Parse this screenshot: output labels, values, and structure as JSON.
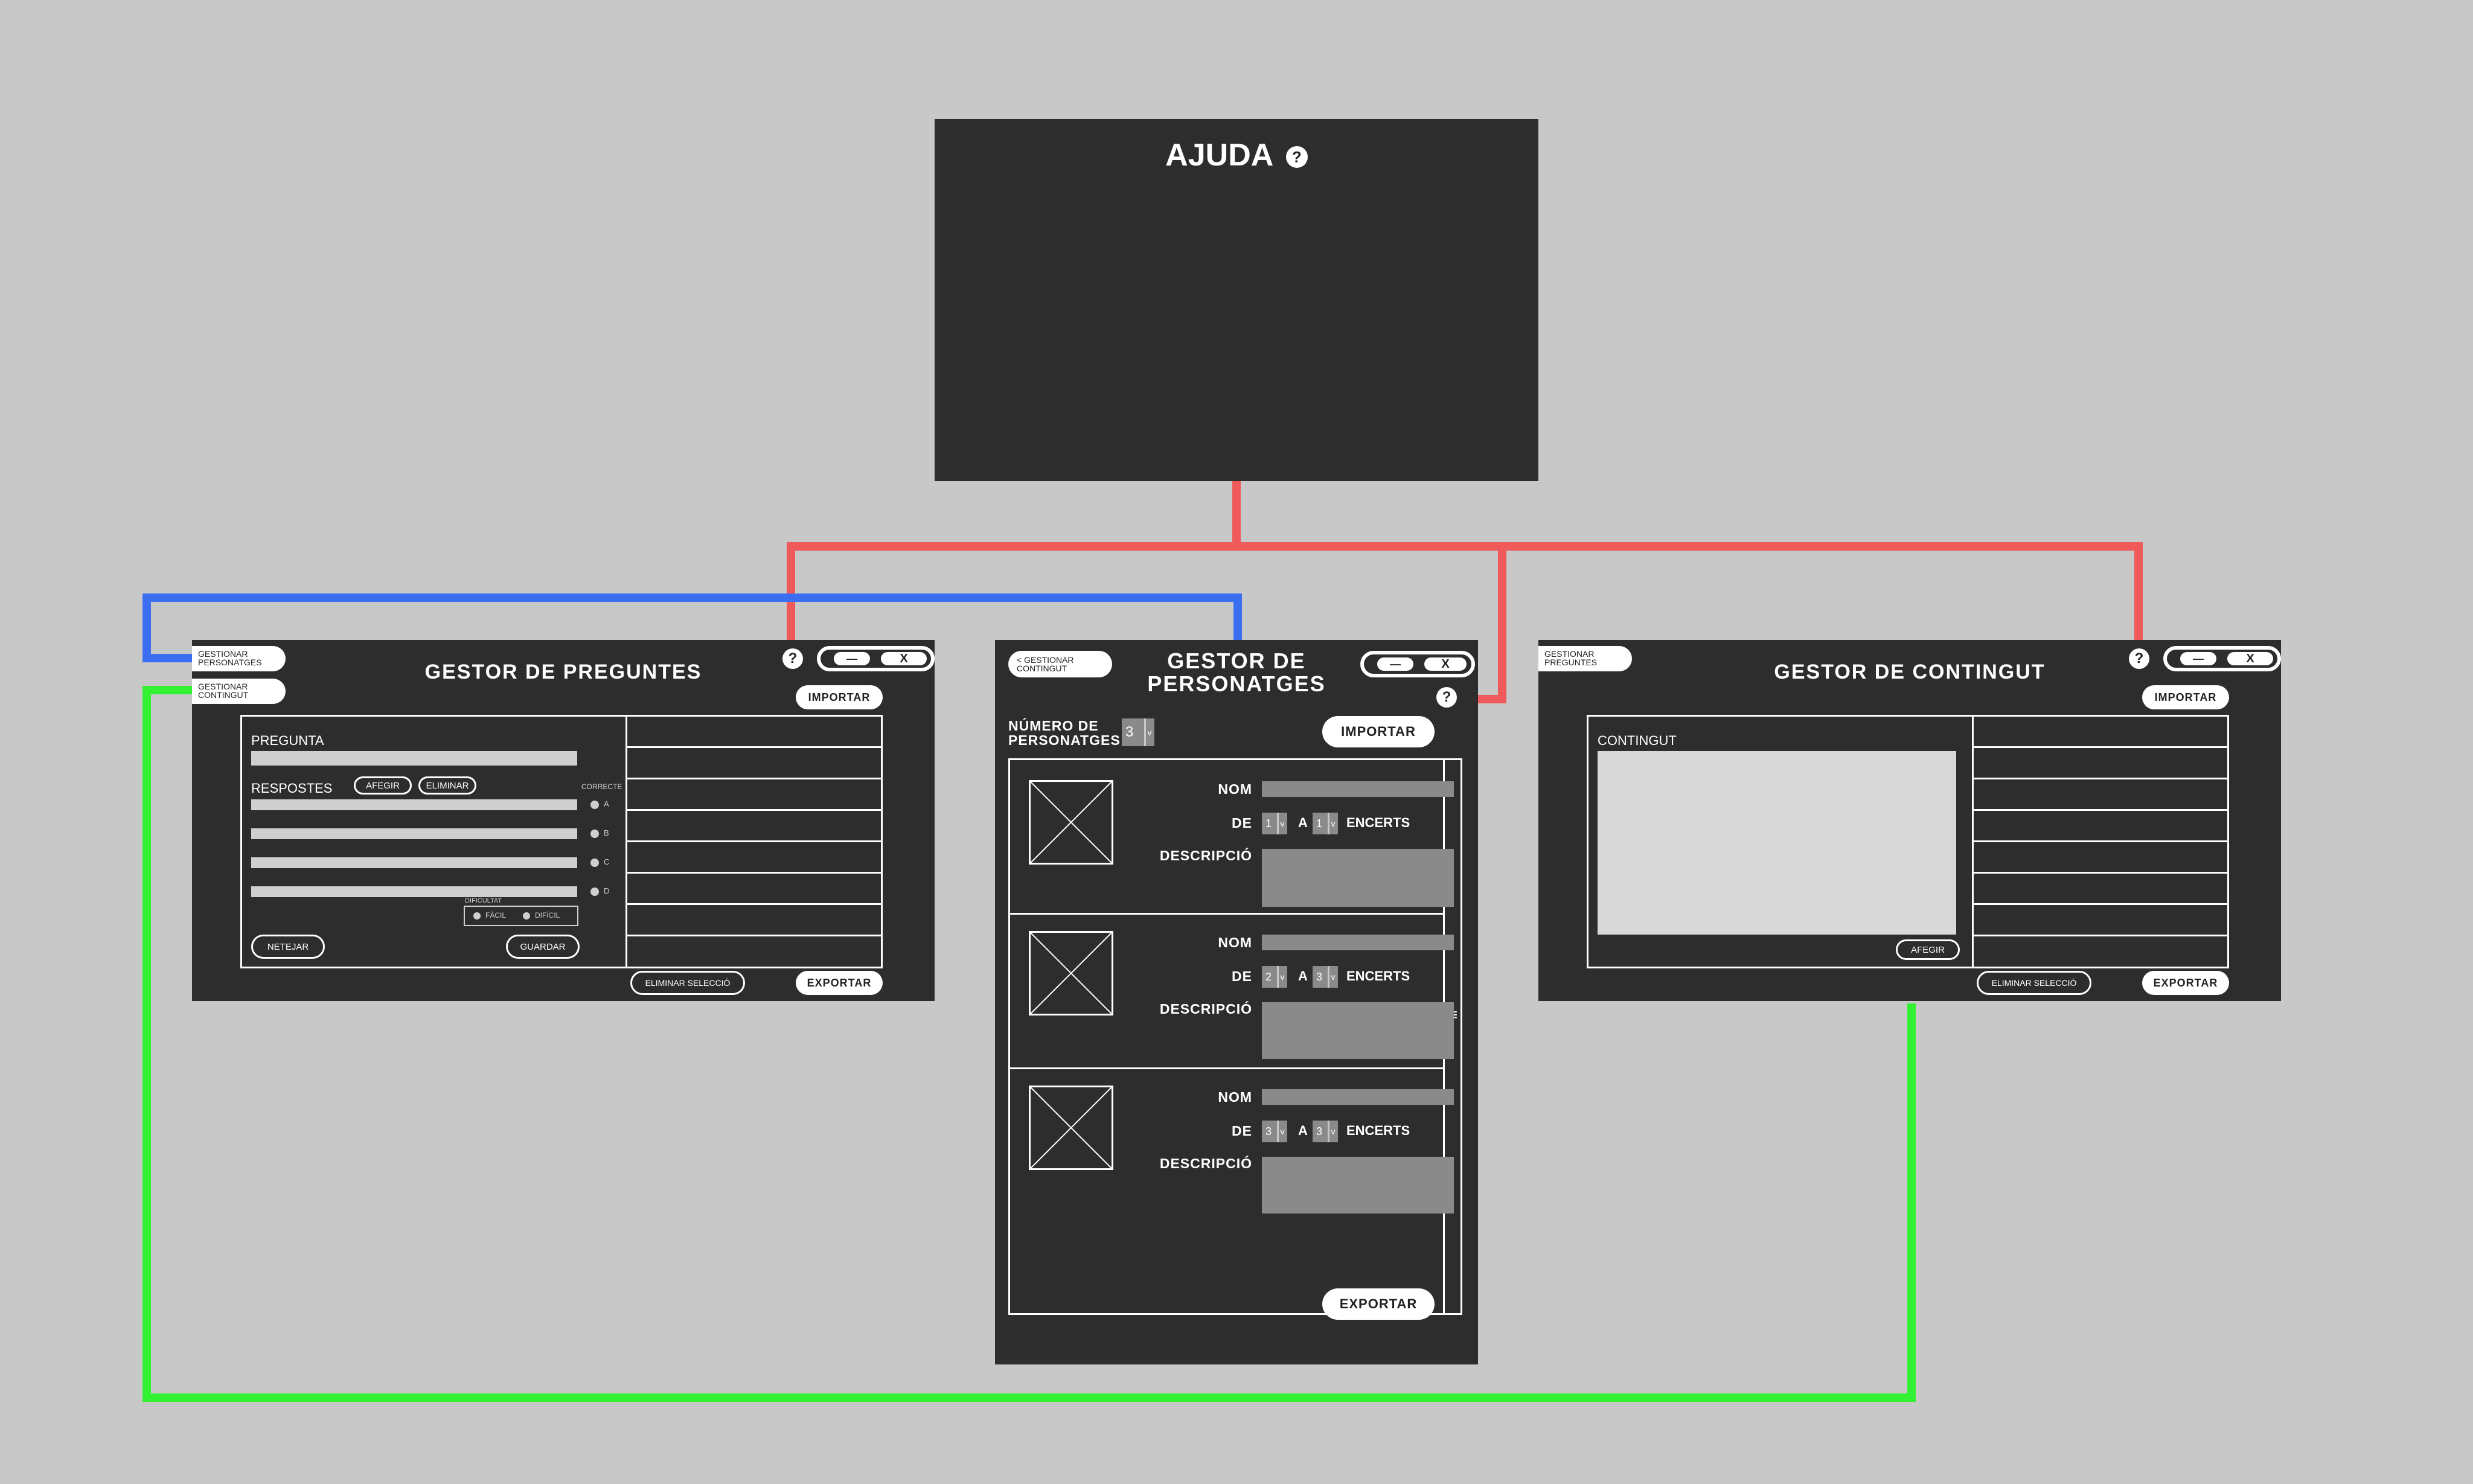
{
  "colors": {
    "background": "#c8c8c8",
    "panel": "#2d2d2d",
    "connector_help": "#f05a5a",
    "connector_personatges": "#3b6ef0",
    "connector_contingut": "#33f033"
  },
  "help_panel": {
    "title": "AJUDA",
    "help_icon": "?"
  },
  "questions_window": {
    "title": "GESTOR DE PREGUNTES",
    "nav_personatges": "GESTIONAR PERSONATGES",
    "nav_contingut": "GESTIONAR CONTINGUT",
    "help_icon": "?",
    "minimize_icon": "—",
    "close_icon": "X",
    "import_label": "IMPORTAR",
    "export_label": "EXPORTAR",
    "delete_selection_label": "ELIMINAR SELECCIÓ",
    "question_label": "PREGUNTA",
    "answers_label": "RESPOSTES",
    "add_label": "AFEGIR",
    "delete_label": "ELIMINAR",
    "correct_label": "CORRECTE",
    "options": [
      "A",
      "B",
      "C",
      "D"
    ],
    "difficulty_label": "DIFICULTAT",
    "difficulty_easy": "FÀCIL",
    "difficulty_hard": "DIFÍCIL",
    "clear_label": "NETEJAR",
    "save_label": "GUARDAR"
  },
  "characters_window": {
    "title_line1": "GESTOR DE",
    "title_line2": "PERSONATGES",
    "back_label": "< GESTIONAR CONTINGUT",
    "help_icon": "?",
    "minimize_icon": "—",
    "close_icon": "X",
    "count_label_line1": "NÚMERO DE",
    "count_label_line2": "PERSONATGES",
    "count_value": "3",
    "import_label": "IMPORTAR",
    "export_label": "EXPORTAR",
    "name_label": "NOM",
    "from_label": "DE",
    "to_label": "A",
    "hits_label": "ENCERTS",
    "description_label": "DESCRIPCIÓ",
    "scroll_icon": "≡",
    "cards": [
      {
        "from": "1",
        "to": "1"
      },
      {
        "from": "2",
        "to": "3"
      },
      {
        "from": "3",
        "to": "3"
      }
    ]
  },
  "content_window": {
    "title": "GESTOR DE CONTINGUT",
    "nav_preguntes": "GESTIONAR PREGUNTES",
    "help_icon": "?",
    "minimize_icon": "—",
    "close_icon": "X",
    "import_label": "IMPORTAR",
    "export_label": "EXPORTAR",
    "delete_selection_label": "ELIMINAR SELECCIÓ",
    "content_label": "CONTINGUT",
    "add_label": "AFEGIR"
  }
}
